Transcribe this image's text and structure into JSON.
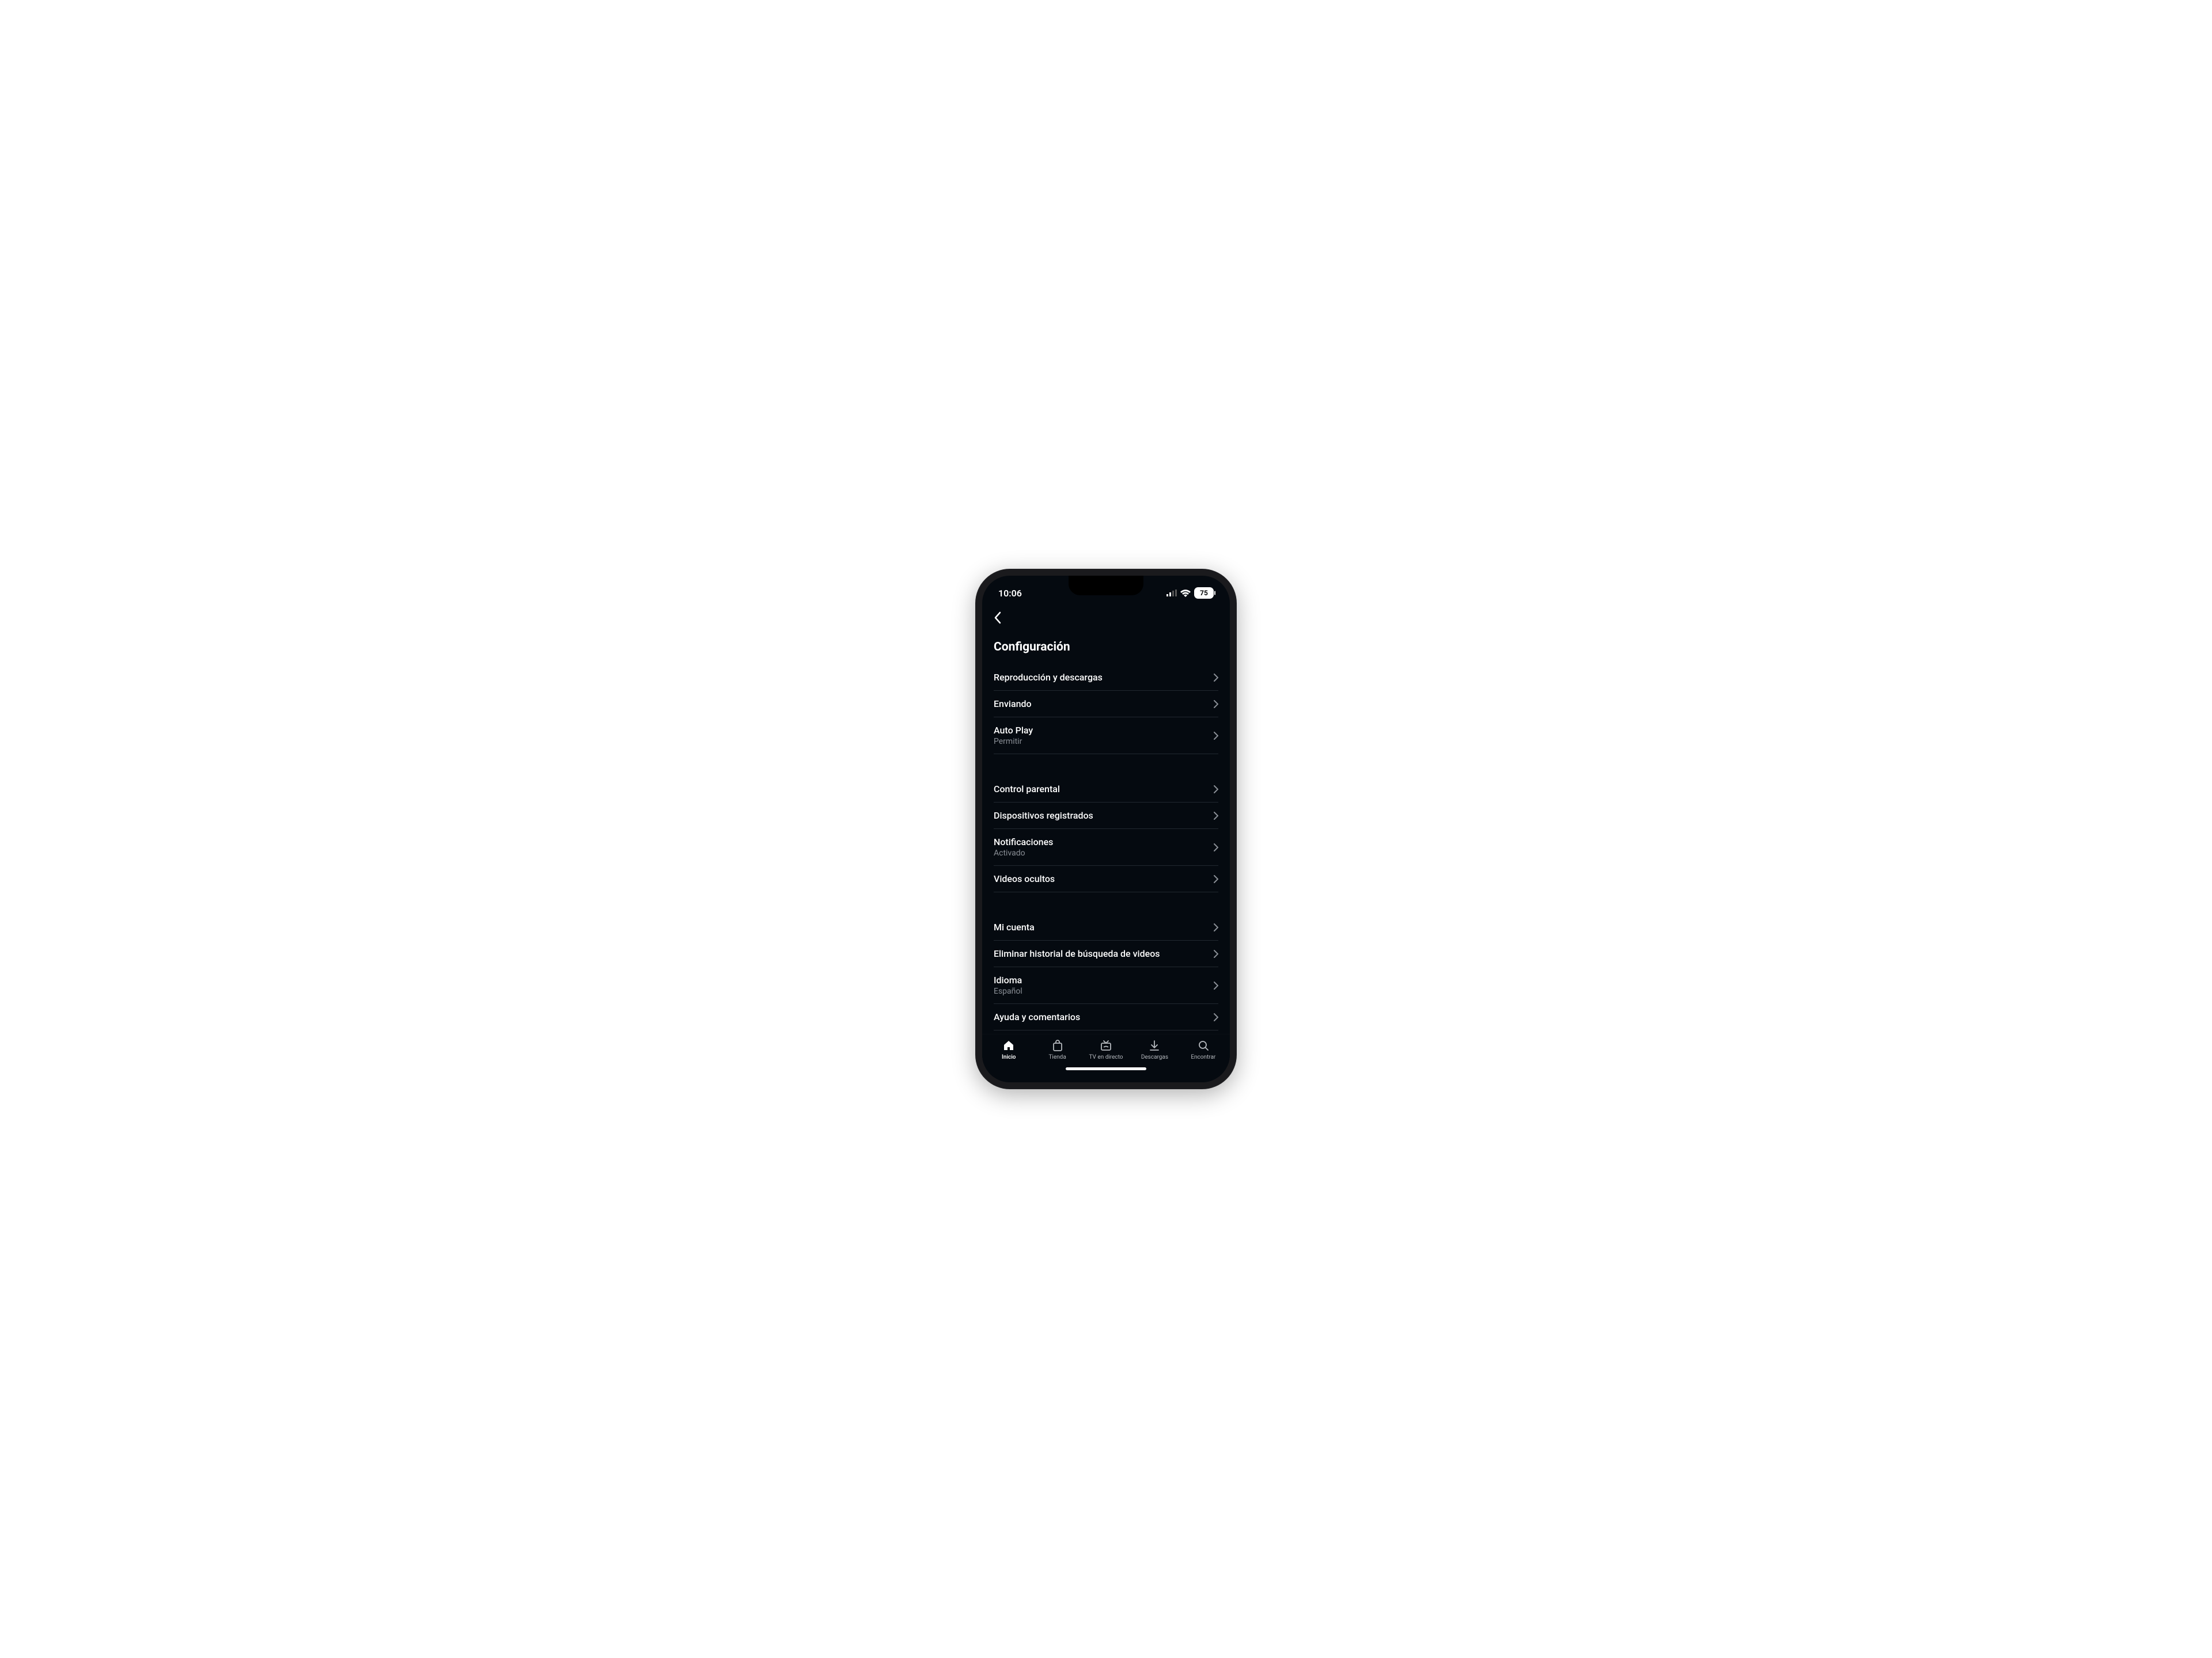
{
  "status": {
    "time": "10:06",
    "battery": "75"
  },
  "header": {
    "title": "Configuración"
  },
  "groups": [
    {
      "rows": [
        {
          "label": "Reproducción y descargas",
          "sub": ""
        },
        {
          "label": "Enviando",
          "sub": ""
        },
        {
          "label": "Auto Play",
          "sub": "Permitir"
        }
      ]
    },
    {
      "rows": [
        {
          "label": "Control parental",
          "sub": ""
        },
        {
          "label": "Dispositivos registrados",
          "sub": ""
        },
        {
          "label": "Notificaciones",
          "sub": "Activado"
        },
        {
          "label": "Videos ocultos",
          "sub": ""
        }
      ]
    },
    {
      "rows": [
        {
          "label": "Mi cuenta",
          "sub": ""
        },
        {
          "label": "Eliminar historial de búsqueda de videos",
          "sub": ""
        },
        {
          "label": "Idioma",
          "sub": "Español"
        },
        {
          "label": "Ayuda y comentarios",
          "sub": ""
        }
      ]
    }
  ],
  "tabs": {
    "home": "Inicio",
    "store": "Tienda",
    "live": "TV en directo",
    "downloads": "Descargas",
    "find": "Encontrar"
  }
}
